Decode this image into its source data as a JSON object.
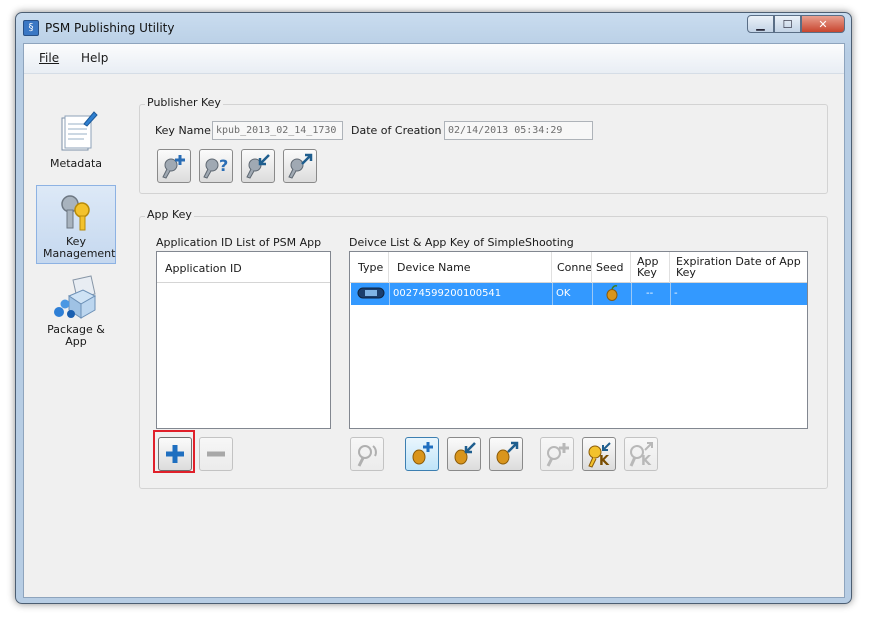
{
  "window": {
    "title": "PSM Publishing Utility"
  },
  "menu": {
    "file": "File",
    "help": "Help"
  },
  "nav": [
    {
      "label": "Metadata",
      "icon": "metadata-icon"
    },
    {
      "label": "Key Management",
      "icon": "key-management-icon",
      "active": true
    },
    {
      "label": "Package & App",
      "icon": "package-app-icon"
    }
  ],
  "publisher_key": {
    "group_label": "Publisher Key",
    "key_name_label": "Key Name",
    "key_name_value": "kpub_2013_02_14_1730",
    "date_label": "Date of Creation",
    "date_value": "02/14/2013 05:34:29",
    "buttons": [
      "create-key-icon",
      "check-key-icon",
      "import-key-icon",
      "export-key-icon"
    ]
  },
  "app_key": {
    "group_label": "App Key",
    "app_list_label": "Application ID List of PSM App",
    "app_list_header": "Application ID",
    "device_list_label": "Deivce List & App Key of SimpleShooting",
    "columns": [
      "Type",
      "Device Name",
      "Conne",
      "Seed",
      "App Key",
      "Expiration Date of App Key"
    ],
    "rows": [
      {
        "type_icon": "psvita-icon",
        "device_name": "00274599200100541",
        "connection": "OK",
        "seed_icon": "seed-icon",
        "app_key": "--",
        "expiration": "-"
      }
    ]
  },
  "colors": {
    "selection": "#3399ff",
    "highlight_box": "#e0202a",
    "add_button": "#1f6fc0"
  }
}
